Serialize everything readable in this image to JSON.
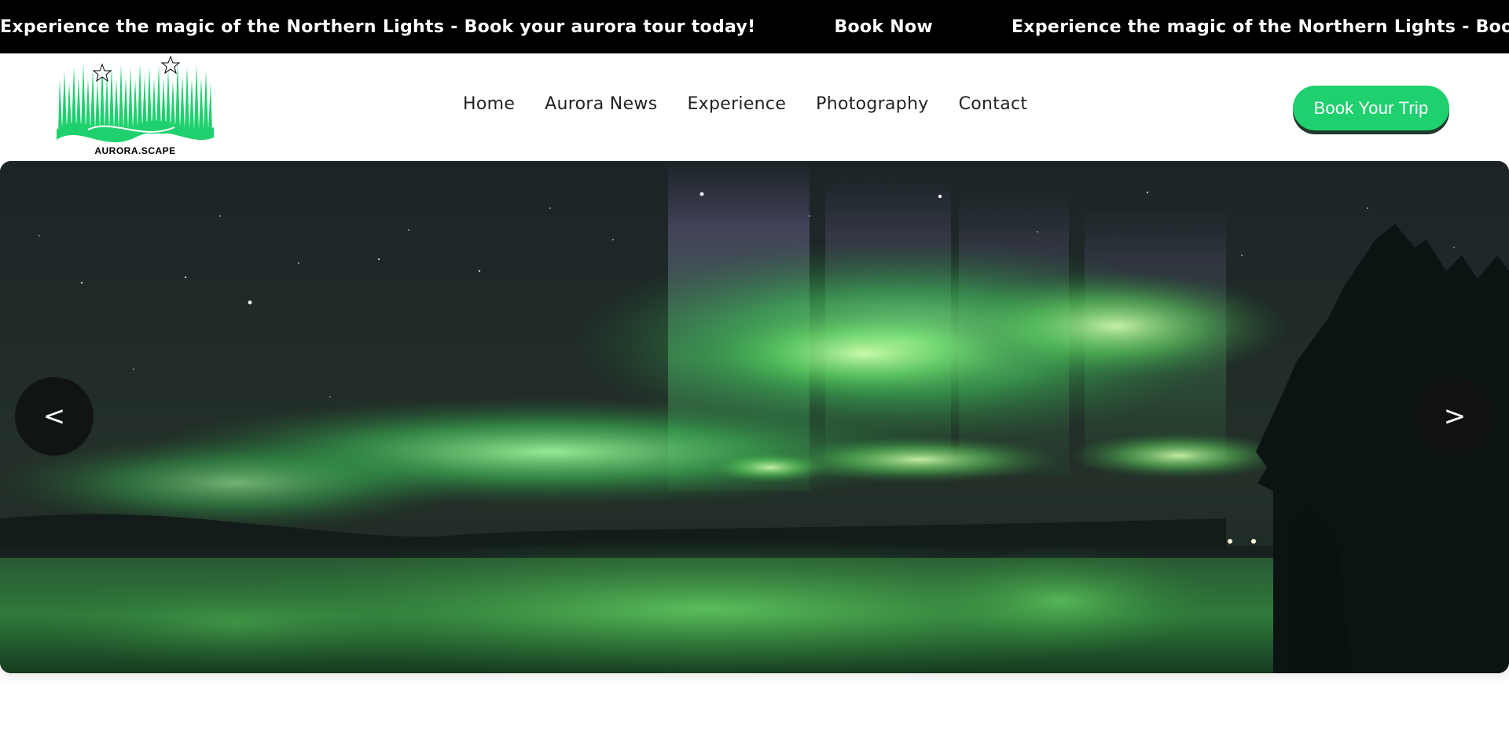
{
  "announcement": {
    "message": "Experience the magic of the Northern Lights - Book your aurora tour today!",
    "link": "Book Now"
  },
  "brand": {
    "name": "AURORA.SCAPE",
    "logo_color": "#1fd16e"
  },
  "nav": {
    "items": [
      {
        "label": "Home"
      },
      {
        "label": "Aurora News"
      },
      {
        "label": "Experience"
      },
      {
        "label": "Photography"
      },
      {
        "label": "Contact"
      }
    ]
  },
  "header": {
    "cta_label": "Book Your Trip",
    "accent_color": "#1fd16e"
  },
  "carousel": {
    "prev_label": "<",
    "next_label": ">",
    "slide_description_icon": "aurora-landscape-image"
  }
}
